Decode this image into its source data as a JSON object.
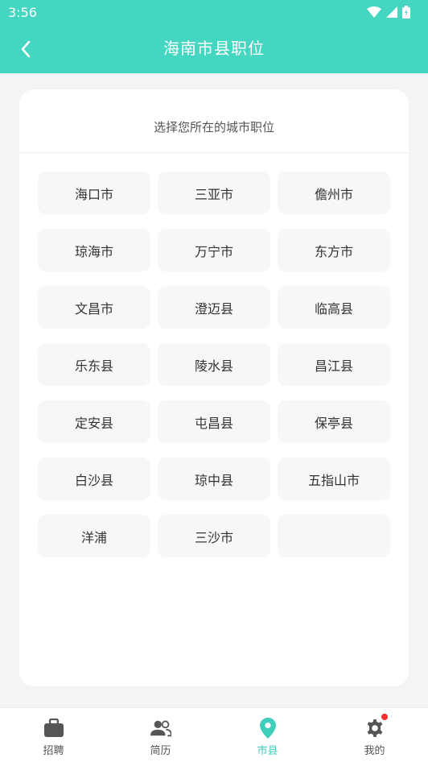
{
  "status": {
    "time": "3:56"
  },
  "header": {
    "title": "海南市县职位"
  },
  "card": {
    "subtitle": "选择您所在的城市职位"
  },
  "cities": [
    "海口市",
    "三亚市",
    "儋州市",
    "琼海市",
    "万宁市",
    "东方市",
    "文昌市",
    "澄迈县",
    "临高县",
    "乐东县",
    "陵水县",
    "昌江县",
    "定安县",
    "屯昌县",
    "保亭县",
    "白沙县",
    "琼中县",
    "五指山市",
    "洋浦",
    "三沙市",
    ""
  ],
  "tabs": [
    {
      "label": "招聘",
      "icon": "briefcase-icon"
    },
    {
      "label": "简历",
      "icon": "people-icon"
    },
    {
      "label": "市县",
      "icon": "location-pin-icon",
      "active": true
    },
    {
      "label": "我的",
      "icon": "gear-icon",
      "badge": true
    }
  ],
  "colors": {
    "accent": "#44d6c1",
    "badge": "#ff2a2a"
  }
}
